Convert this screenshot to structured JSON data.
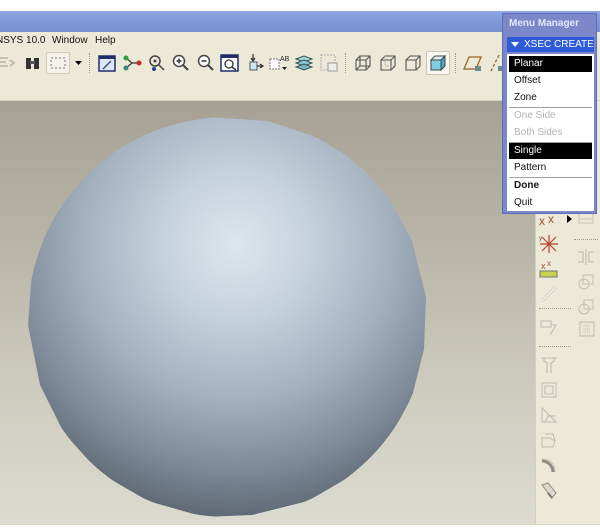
{
  "window": {
    "title_fragment": "NSYS 10.0"
  },
  "menubar": {
    "items": [
      {
        "label": "NSYS 10.0"
      },
      {
        "label": "Window"
      },
      {
        "label": "Help"
      }
    ]
  },
  "toolbar": {
    "icons": [
      "redo-icon",
      "find-binoculars-icon",
      "selection-box-icon",
      "dropdown-arrow-icon",
      "sketch-display-icon",
      "datum-points-icon",
      "orient-view-icon",
      "zoom-in-icon",
      "zoom-out-icon",
      "refit-icon",
      "spin-center-icon",
      "annotation-icon",
      "layers-icon",
      "view-manager-icon",
      "wireframe-icon",
      "hidden-line-icon",
      "no-hidden-icon",
      "shaded-icon",
      "datum-plane-icon",
      "datum-axis-icon"
    ]
  },
  "menu_manager": {
    "title": "Menu Manager",
    "header": "XSEC CREATE",
    "items": [
      {
        "label": "Planar",
        "state": "selected"
      },
      {
        "label": "Offset",
        "state": "normal"
      },
      {
        "label": "Zone",
        "state": "normal"
      },
      {
        "label": "One Side",
        "state": "disabled"
      },
      {
        "label": "Both Sides",
        "state": "disabled"
      },
      {
        "label": "Single",
        "state": "selected"
      },
      {
        "label": "Pattern",
        "state": "normal"
      },
      {
        "label": "Done",
        "state": "bold"
      },
      {
        "label": "Quit",
        "state": "normal"
      }
    ]
  },
  "right_toolbar": {
    "icons": [
      "datum-point-icon",
      "sketched-point-icon",
      "offset-point-icon",
      "datum-curve-icon",
      "sketch-tool-icon",
      "hole-icon",
      "shell-icon",
      "rib-icon",
      "draft-icon",
      "round-icon",
      "chamfer-icon",
      "mirror-icon",
      "merge-icon",
      "pattern-icon",
      "table-icon"
    ]
  },
  "colors": {
    "menu_manager_bg": "#7c87c9",
    "menu_header": "#2f5bd6",
    "selected_bg": "#000000",
    "toolbar_bg": "#ece9d8"
  }
}
